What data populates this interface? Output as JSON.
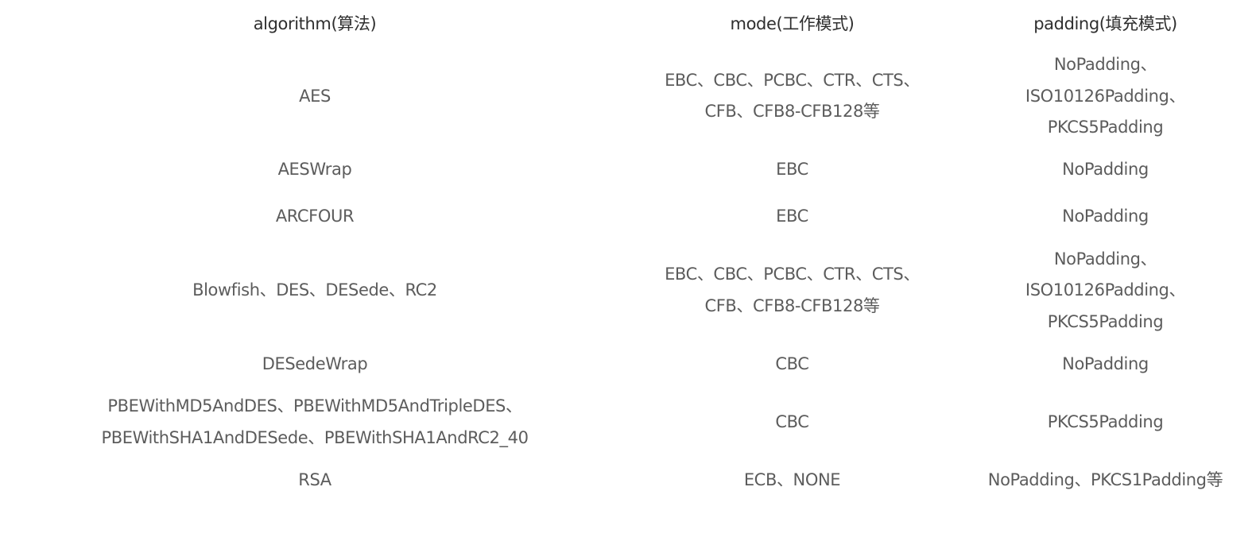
{
  "table": {
    "headers": {
      "algorithm": "algorithm(算法)",
      "mode": "mode(工作模式)",
      "padding": "padding(填充模式)"
    },
    "rows": [
      {
        "algorithm": [
          "AES"
        ],
        "mode": [
          "EBC、CBC、PCBC、CTR、CTS、",
          "CFB、CFB8-CFB128等"
        ],
        "padding": [
          "NoPadding、",
          "ISO10126Padding、",
          "PKCS5Padding"
        ]
      },
      {
        "algorithm": [
          "AESWrap"
        ],
        "mode": [
          "EBC"
        ],
        "padding": [
          "NoPadding"
        ]
      },
      {
        "algorithm": [
          "ARCFOUR"
        ],
        "mode": [
          "EBC"
        ],
        "padding": [
          "NoPadding"
        ]
      },
      {
        "algorithm": [
          "Blowfish、DES、DESede、RC2"
        ],
        "mode": [
          "EBC、CBC、PCBC、CTR、CTS、",
          "CFB、CFB8-CFB128等"
        ],
        "padding": [
          "NoPadding、",
          "ISO10126Padding、",
          "PKCS5Padding"
        ]
      },
      {
        "algorithm": [
          "DESedeWrap"
        ],
        "mode": [
          "CBC"
        ],
        "padding": [
          "NoPadding"
        ]
      },
      {
        "algorithm": [
          "PBEWithMD5AndDES、PBEWithMD5AndTripleDES、",
          "PBEWithSHA1AndDESede、PBEWithSHA1AndRC2_40"
        ],
        "mode": [
          "CBC"
        ],
        "padding": [
          "PKCS5Padding"
        ]
      },
      {
        "algorithm": [
          "RSA"
        ],
        "mode": [
          "ECB、NONE"
        ],
        "padding": [
          "NoPadding、PKCS1Padding等"
        ]
      }
    ]
  }
}
